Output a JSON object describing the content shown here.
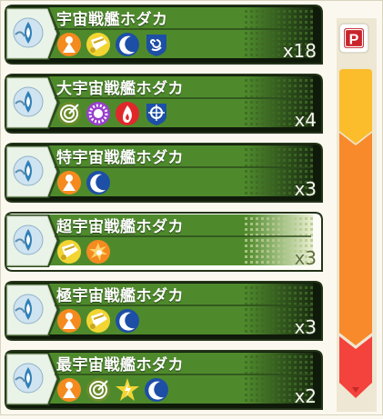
{
  "ships": [
    {
      "name": "宇宙戦艦ホダカ",
      "count": "x18",
      "icons": [
        "cone-icon",
        "hourglass-icon",
        "crescent-icon",
        "spiral-shield-icon"
      ]
    },
    {
      "name": "大宇宙戦艦ホダカ",
      "count": "x4",
      "icons": [
        "target-spiral-icon",
        "gear-burst-icon",
        "flame-icon",
        "crosshair-shield-icon"
      ]
    },
    {
      "name": "特宇宙戦艦ホダカ",
      "count": "x3",
      "icons": [
        "cone-icon",
        "crescent-icon"
      ]
    },
    {
      "name": "超宇宙戦艦ホダカ",
      "count": "x3",
      "icons": [
        "hourglass-icon",
        "burst-person-icon"
      ]
    },
    {
      "name": "極宇宙戦艦ホダカ",
      "count": "x3",
      "icons": [
        "cone-icon",
        "hourglass-icon",
        "crescent-icon"
      ]
    },
    {
      "name": "最宇宙戦艦ホダカ",
      "count": "x2",
      "icons": [
        "cone-icon",
        "target-spiral-icon",
        "lightning-star-icon",
        "crescent-icon"
      ]
    }
  ],
  "side_panel": {
    "p_button_label": "P",
    "colors": {
      "yellow": "#fbbd2c",
      "orange": "#f98a2c",
      "red": "#f4423c"
    }
  },
  "colors": {
    "row_green": "#4e8a2c",
    "row_dark": "#1a2c12",
    "row_border": "#243319",
    "highlight_row": "#dfe8c0"
  }
}
